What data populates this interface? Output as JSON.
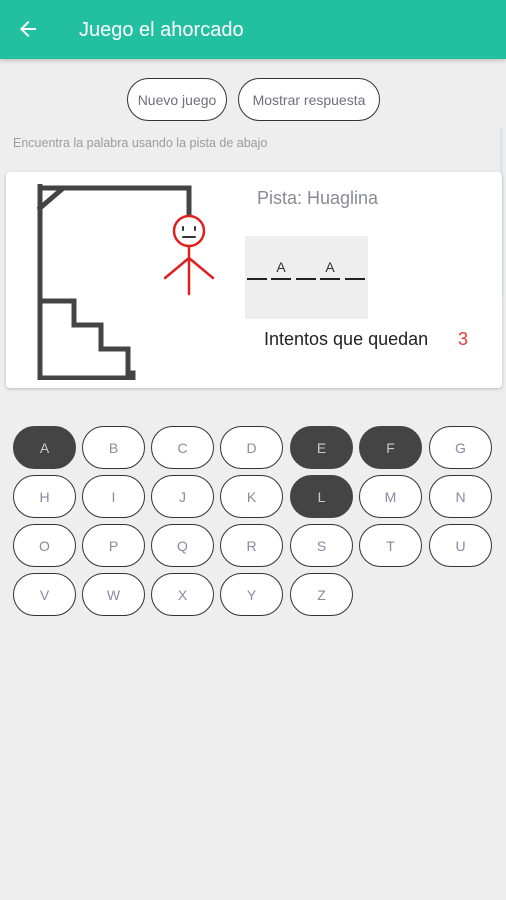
{
  "app": {
    "title": "Juego el ahorcado"
  },
  "toolbar": {
    "new_game_label": "Nuevo juego",
    "show_answer_label": "Mostrar respuesta"
  },
  "instructions": "Encuentra la palabra usando la pista de abajo",
  "hint": {
    "label": "Pista: Huaglina"
  },
  "word": {
    "slots": [
      "",
      "A",
      "",
      "A",
      ""
    ]
  },
  "attempts": {
    "label": "Intentos que quedan",
    "value": "3"
  },
  "keyboard": {
    "keys": [
      {
        "letter": "A",
        "used": true
      },
      {
        "letter": "B",
        "used": false
      },
      {
        "letter": "C",
        "used": false
      },
      {
        "letter": "D",
        "used": false
      },
      {
        "letter": "E",
        "used": true
      },
      {
        "letter": "F",
        "used": true
      },
      {
        "letter": "G",
        "used": false
      },
      {
        "letter": "H",
        "used": false
      },
      {
        "letter": "I",
        "used": false
      },
      {
        "letter": "J",
        "used": false
      },
      {
        "letter": "K",
        "used": false
      },
      {
        "letter": "L",
        "used": true
      },
      {
        "letter": "M",
        "used": false
      },
      {
        "letter": "N",
        "used": false
      },
      {
        "letter": "O",
        "used": false
      },
      {
        "letter": "P",
        "used": false
      },
      {
        "letter": "Q",
        "used": false
      },
      {
        "letter": "R",
        "used": false
      },
      {
        "letter": "S",
        "used": false
      },
      {
        "letter": "T",
        "used": false
      },
      {
        "letter": "U",
        "used": false
      },
      {
        "letter": "V",
        "used": false
      },
      {
        "letter": "W",
        "used": false
      },
      {
        "letter": "X",
        "used": false
      },
      {
        "letter": "Y",
        "used": false
      },
      {
        "letter": "Z",
        "used": false
      }
    ]
  },
  "colors": {
    "accent": "#22bfa0",
    "used_key": "#444444",
    "attempts_value": "#e53935",
    "hangman": "#e02020"
  },
  "icons": {
    "back": "arrow-left-icon"
  }
}
